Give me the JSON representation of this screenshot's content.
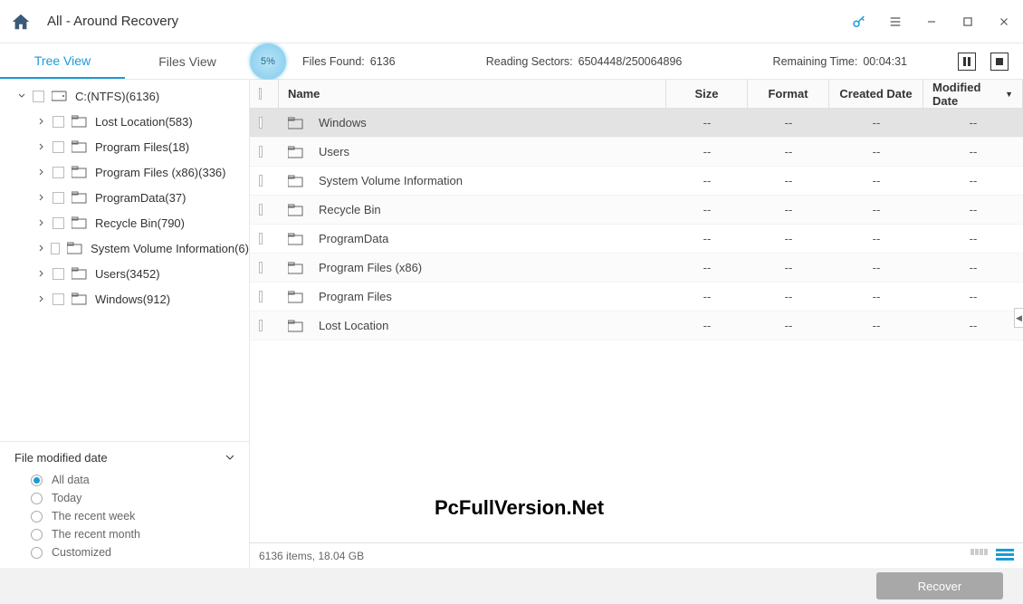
{
  "title": "All - Around Recovery",
  "tabs": {
    "tree": "Tree View",
    "files": "Files View"
  },
  "progress": {
    "percent": "5%",
    "found_label": "Files Found:",
    "found_value": "6136",
    "sectors_label": "Reading Sectors:",
    "sectors_value": "6504448/250064896",
    "remaining_label": "Remaining Time:",
    "remaining_value": "00:04:31"
  },
  "tree": {
    "root": "C:(NTFS)(6136)",
    "children": [
      "Lost Location(583)",
      "Program Files(18)",
      "Program Files (x86)(336)",
      "ProgramData(37)",
      "Recycle Bin(790)",
      "System Volume Information(6)",
      "Users(3452)",
      "Windows(912)"
    ]
  },
  "filter": {
    "heading": "File modified date",
    "options": [
      "All data",
      "Today",
      "The recent week",
      "The recent month",
      "Customized"
    ]
  },
  "columns": {
    "name": "Name",
    "size": "Size",
    "format": "Format",
    "created": "Created Date",
    "modified": "Modified Date"
  },
  "rows": [
    {
      "name": "Windows",
      "size": "--",
      "format": "--",
      "created": "--",
      "modified": "--"
    },
    {
      "name": "Users",
      "size": "--",
      "format": "--",
      "created": "--",
      "modified": "--"
    },
    {
      "name": "System Volume Information",
      "size": "--",
      "format": "--",
      "created": "--",
      "modified": "--"
    },
    {
      "name": "Recycle Bin",
      "size": "--",
      "format": "--",
      "created": "--",
      "modified": "--"
    },
    {
      "name": "ProgramData",
      "size": "--",
      "format": "--",
      "created": "--",
      "modified": "--"
    },
    {
      "name": "Program Files (x86)",
      "size": "--",
      "format": "--",
      "created": "--",
      "modified": "--"
    },
    {
      "name": "Program Files",
      "size": "--",
      "format": "--",
      "created": "--",
      "modified": "--"
    },
    {
      "name": "Lost Location",
      "size": "--",
      "format": "--",
      "created": "--",
      "modified": "--"
    }
  ],
  "status": "6136 items, 18.04 GB",
  "recover": "Recover",
  "watermark": "PcFullVersion.Net"
}
